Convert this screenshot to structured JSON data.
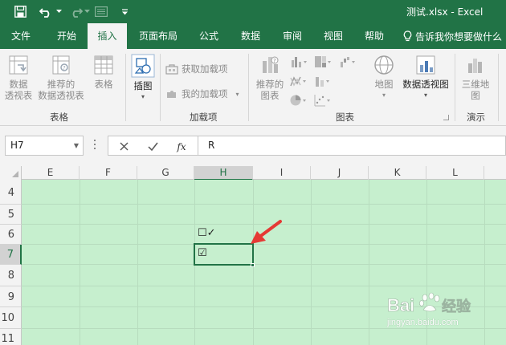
{
  "title_bar": {
    "title": "测试.xlsx  -  Excel",
    "icons": [
      "save-icon",
      "undo-icon",
      "redo-icon",
      "form-icon",
      "customize-qat-icon"
    ]
  },
  "tabs": {
    "items": [
      "文件",
      "开始",
      "插入",
      "页面布局",
      "公式",
      "数据",
      "审阅",
      "视图",
      "帮助"
    ],
    "active": "插入",
    "tell_me": "告诉我你想要做什么"
  },
  "ribbon": {
    "groups": {
      "tables": {
        "label": "表格",
        "pivot_table": [
          "数据",
          "透视表"
        ],
        "recommended_pivot": [
          "推荐的",
          "数据透视表"
        ],
        "table": "表格"
      },
      "illustrations": {
        "label": "插图"
      },
      "addins": {
        "label": "加载项",
        "get_addins": "获取加载项",
        "my_addins": "我的加载项"
      },
      "charts": {
        "label": "图表",
        "recommended_charts": [
          "推荐的",
          "图表"
        ],
        "map": "地图",
        "pivot_chart": "数据透视图"
      },
      "tours": {
        "label": "演示",
        "map3d": [
          "三维地",
          "图"
        ]
      }
    }
  },
  "formula_bar": {
    "name_box": "H7",
    "formula": "R",
    "fx_label": "fx"
  },
  "grid": {
    "columns": [
      "E",
      "F",
      "G",
      "H",
      "I",
      "J",
      "K",
      "L"
    ],
    "rows": [
      "4",
      "5",
      "6",
      "7",
      "8",
      "9",
      "10",
      "11"
    ],
    "selected_column": "H",
    "selected_row": "7",
    "cells": {
      "H6": "☐✓",
      "H7": "☑"
    },
    "fill_color": "#c6efce"
  },
  "colors": {
    "brand_green": "#217346",
    "arrow_red": "#e53935"
  },
  "watermark": {
    "brand": "Bai 经验",
    "url": "jingyan.baidu.com"
  }
}
